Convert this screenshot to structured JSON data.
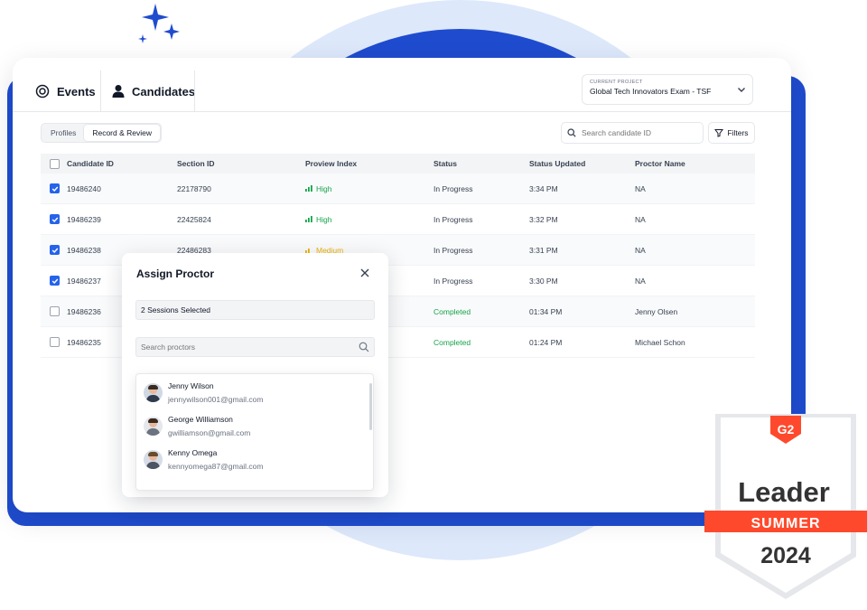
{
  "nav": {
    "events_label": "Events",
    "candidates_label": "Candidates"
  },
  "project": {
    "label": "CURRENT PROJECT",
    "value": "Global Tech Innovators Exam - TSF"
  },
  "segments": {
    "profiles": "Profiles",
    "record_review": "Record & Review",
    "active": "Record & Review"
  },
  "search": {
    "placeholder": "Search candidate ID"
  },
  "filters_label": "Filters",
  "table": {
    "headers": [
      "Candidate ID",
      "Section ID",
      "Proview Index",
      "Status",
      "Status Updated",
      "Proctor Name"
    ],
    "rows": [
      {
        "checked": true,
        "candidate_id": "19486240",
        "section_id": "22178790",
        "proview_index": "High",
        "status": "In Progress",
        "updated": "3:34 PM",
        "proctor": "NA"
      },
      {
        "checked": true,
        "candidate_id": "19486239",
        "section_id": "22425824",
        "proview_index": "High",
        "status": "In Progress",
        "updated": "3:32 PM",
        "proctor": "NA"
      },
      {
        "checked": true,
        "candidate_id": "19486238",
        "section_id": "22486283",
        "proview_index": "Medium",
        "status": "In Progress",
        "updated": "3:31 PM",
        "proctor": "NA"
      },
      {
        "checked": true,
        "candidate_id": "19486237",
        "section_id": "",
        "proview_index": "",
        "status": "In Progress",
        "updated": "3:30 PM",
        "proctor": "NA"
      },
      {
        "checked": false,
        "candidate_id": "19486236",
        "section_id": "",
        "proview_index": "",
        "status": "Completed",
        "updated": "01:34 PM",
        "proctor": "Jenny Olsen"
      },
      {
        "checked": false,
        "candidate_id": "19486235",
        "section_id": "",
        "proview_index": "",
        "status": "Completed",
        "updated": "01:24 PM",
        "proctor": "Michael Schon"
      }
    ]
  },
  "modal": {
    "title": "Assign Proctor",
    "sessions_value": "2 Sessions Selected",
    "search_placeholder": "Search proctors",
    "proctors": [
      {
        "name": "Jenny Wilson",
        "email": "jennywilson001@gmail.com"
      },
      {
        "name": "George Williamson",
        "email": "gwilliamson@gmail.com"
      },
      {
        "name": "Kenny Omega",
        "email": "kennyomega87@gmail.com"
      }
    ]
  },
  "badge": {
    "brand": "G2",
    "title": "Leader",
    "season": "SUMMER",
    "year": "2024"
  },
  "colors": {
    "accent_blue": "#1f4ccf",
    "checkbox_blue": "#2563eb",
    "green": "#16a34a",
    "yellow": "#eab308",
    "g2_red": "#ff492c"
  }
}
